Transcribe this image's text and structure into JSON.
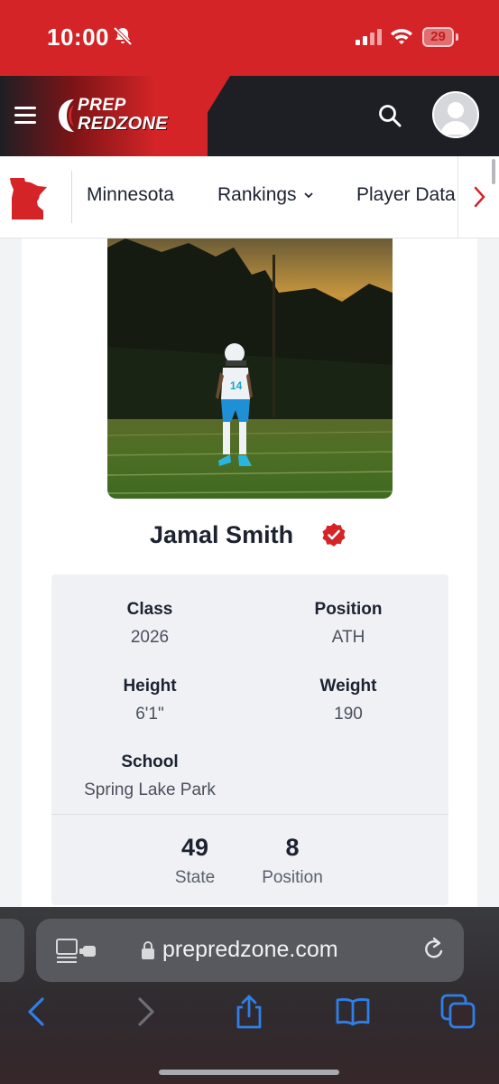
{
  "status_bar": {
    "time": "10:00",
    "battery": "29",
    "icons": [
      "bell-off-icon",
      "signal-icon",
      "wifi-icon",
      "battery-icon"
    ]
  },
  "header": {
    "logo_line1": "PREP",
    "logo_line2": "REDZONE",
    "icons": [
      "menu-icon",
      "search-icon",
      "avatar-icon"
    ]
  },
  "subnav": {
    "state_icon": "minnesota-map-icon",
    "items": [
      {
        "label": "Minnesota"
      },
      {
        "label": "Rankings",
        "has_dropdown": true
      },
      {
        "label": "Player Data"
      }
    ]
  },
  "player": {
    "name": "Jamal Smith",
    "verified": true,
    "photo": "football-player-on-field-photo",
    "jersey_number": "14",
    "fields": [
      {
        "label": "Class",
        "value": "2026"
      },
      {
        "label": "Position",
        "value": "ATH"
      },
      {
        "label": "Height",
        "value": "6'1\""
      },
      {
        "label": "Weight",
        "value": "190"
      },
      {
        "label": "School",
        "value": "Spring Lake Park"
      }
    ],
    "rankings": [
      {
        "value": "49",
        "label": "State"
      },
      {
        "value": "8",
        "label": "Position"
      }
    ]
  },
  "browser": {
    "url": "prepredzone.com",
    "icons": [
      "reader-icon",
      "lock-icon",
      "reload-icon",
      "back-icon",
      "forward-icon",
      "share-icon",
      "bookmarks-icon",
      "tabs-icon"
    ]
  },
  "colors": {
    "brand_red": "#d42427",
    "header_dark": "#1e1f25",
    "toolbar_blue": "#2f7fe8"
  }
}
